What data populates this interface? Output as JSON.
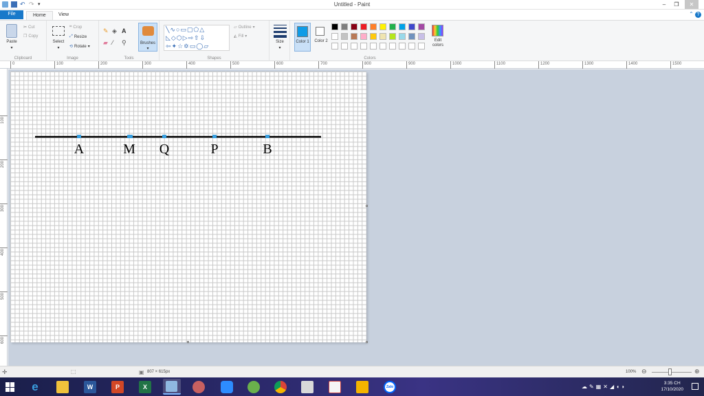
{
  "window": {
    "title": "Untitled - Paint"
  },
  "tabs": {
    "file": "File",
    "home": "Home",
    "view": "View"
  },
  "clipboard": {
    "paste": "Paste",
    "cut": "Cut",
    "copy": "Copy",
    "label": "Clipboard"
  },
  "image": {
    "select": "Select",
    "crop": "Crop",
    "resize": "Resize",
    "rotate": "Rotate",
    "label": "Image"
  },
  "tools": {
    "label": "Tools",
    "brushes": "Brushes"
  },
  "shapes": {
    "label": "Shapes",
    "outline": "Outline",
    "fill": "Fill"
  },
  "size": {
    "label": "Size"
  },
  "colors": {
    "color1": "Color 1",
    "color2": "Color 2",
    "edit": "Edit colors",
    "label": "Colors",
    "color1_value": "#0f9be6",
    "color2_value": "#ffffff",
    "palette_row1": [
      "#000000",
      "#7f7f7f",
      "#880015",
      "#ed1c24",
      "#ff7f27",
      "#fff200",
      "#22b14c",
      "#00a2e8",
      "#3f48cc",
      "#a349a4"
    ],
    "palette_row2": [
      "#ffffff",
      "#c3c3c3",
      "#b97a57",
      "#ffaec9",
      "#ffc90e",
      "#efe4b0",
      "#b5e61d",
      "#99d9ea",
      "#7092be",
      "#c8bfe7"
    ]
  },
  "ruler_h": [
    "0",
    "100",
    "200",
    "300",
    "400",
    "500",
    "600",
    "700",
    "800",
    "900",
    "1000",
    "1100",
    "1200",
    "1300",
    "1400",
    "1500"
  ],
  "ruler_v": [
    "100",
    "200",
    "300",
    "400",
    "500",
    "600"
  ],
  "drawing": {
    "points": [
      {
        "label": "A"
      },
      {
        "label": "M"
      },
      {
        "label": "Q"
      },
      {
        "label": "P"
      },
      {
        "label": "B"
      }
    ]
  },
  "status": {
    "dimensions": "807 × 615px",
    "zoom": "100%"
  },
  "taskbar": {
    "time": "3:35 CH",
    "date": "17/10/2020",
    "zalo": "Zalo"
  }
}
